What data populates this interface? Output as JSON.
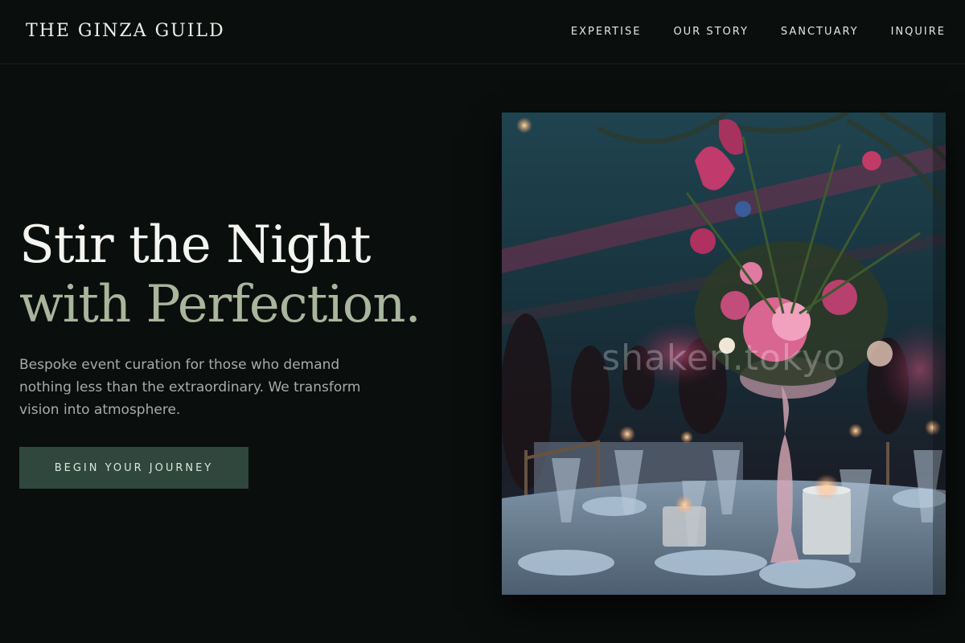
{
  "header": {
    "brand": "THE GINZA GUILD",
    "nav": [
      {
        "label": "EXPERTISE"
      },
      {
        "label": "OUR STORY"
      },
      {
        "label": "SANCTUARY"
      },
      {
        "label": "INQUIRE"
      }
    ]
  },
  "hero": {
    "title_line1": "Stir the Night",
    "title_line2": "with Perfection.",
    "description": "Bespoke event curation for those who demand nothing less than the extraordinary. We transform vision into atmosphere.",
    "cta_label": "BEGIN YOUR JOURNEY",
    "image": {
      "subject": "candlelit-banquet-table-with-floral-centerpiece",
      "watermark": "shaken.tokyo"
    }
  },
  "colors": {
    "background": "#0a0e0d",
    "accent_green": "#2f473d",
    "headline_sage": "#a9b59c"
  }
}
